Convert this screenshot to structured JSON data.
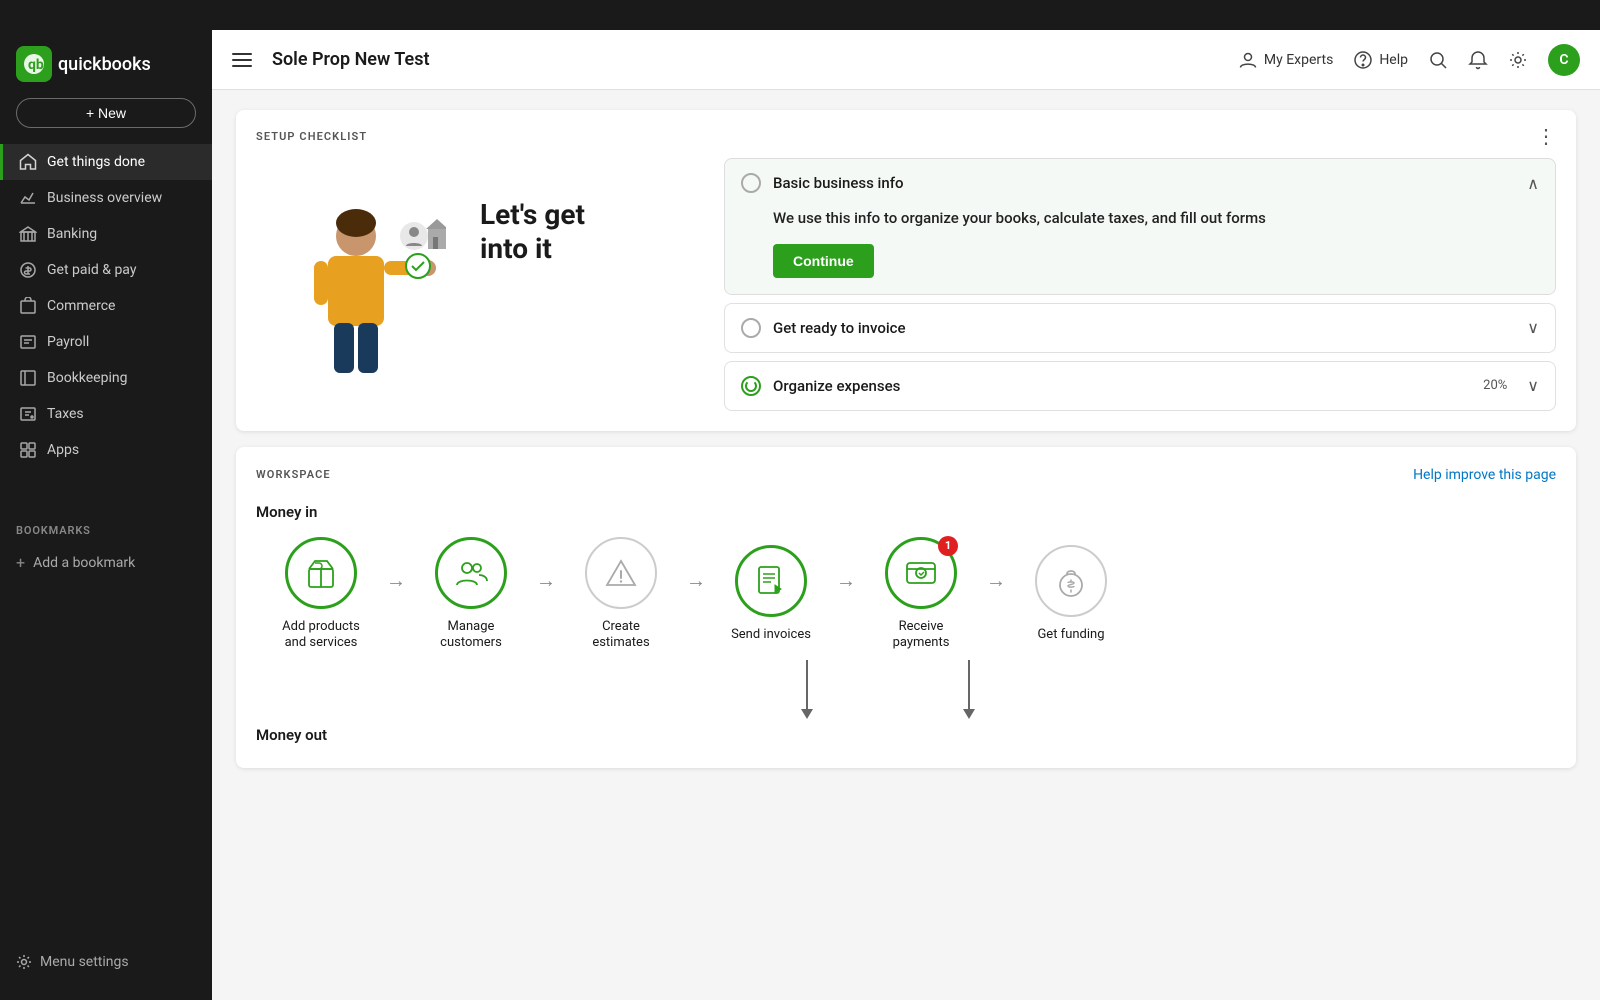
{
  "topbar": {},
  "sidebar": {
    "logo_text": "quickbooks",
    "new_button_label": "+ New",
    "nav_items": [
      {
        "id": "get-things-done",
        "label": "Get things done",
        "icon": "home",
        "active": true
      },
      {
        "id": "business-overview",
        "label": "Business overview",
        "icon": "chart",
        "active": false
      },
      {
        "id": "banking",
        "label": "Banking",
        "icon": "bank",
        "active": false
      },
      {
        "id": "get-paid-pay",
        "label": "Get paid & pay",
        "icon": "dollar",
        "active": false
      },
      {
        "id": "commerce",
        "label": "Commerce",
        "icon": "commerce",
        "active": false
      },
      {
        "id": "payroll",
        "label": "Payroll",
        "icon": "payroll",
        "active": false
      },
      {
        "id": "bookkeeping",
        "label": "Bookkeeping",
        "icon": "book",
        "active": false
      },
      {
        "id": "taxes",
        "label": "Taxes",
        "icon": "tax",
        "active": false
      },
      {
        "id": "apps",
        "label": "Apps",
        "icon": "apps",
        "active": false
      }
    ],
    "bookmarks_label": "BOOKMARKS",
    "add_bookmark_label": "Add a bookmark",
    "menu_settings_label": "Menu settings"
  },
  "header": {
    "title": "Sole Prop New Test",
    "my_experts_label": "My Experts",
    "help_label": "Help",
    "avatar_letter": "C"
  },
  "setup_checklist": {
    "section_label": "SETUP CHECKLIST",
    "title_line1": "Let's get",
    "title_line2": "into it",
    "items": [
      {
        "id": "basic-info",
        "label": "Basic business info",
        "expanded": true,
        "description": "We use this info to organize your books, calculate taxes, and fill out forms",
        "button_label": "Continue",
        "progress": null,
        "radio_state": "empty"
      },
      {
        "id": "invoice",
        "label": "Get ready to invoice",
        "expanded": false,
        "description": "",
        "button_label": "",
        "progress": null,
        "radio_state": "empty"
      },
      {
        "id": "expenses",
        "label": "Organize expenses",
        "expanded": false,
        "description": "",
        "button_label": "",
        "progress": "20%",
        "radio_state": "progress"
      }
    ]
  },
  "workspace": {
    "section_label": "WORKSPACE",
    "help_improve_label": "Help improve this page",
    "money_in_label": "Money in",
    "money_out_label": "Money out",
    "workflow_items": [
      {
        "id": "add-products",
        "label": "Add products\nand services",
        "icon": "box",
        "active": true,
        "badge": null
      },
      {
        "id": "manage-customers",
        "label": "Manage\ncustomers",
        "icon": "people",
        "active": true,
        "badge": null
      },
      {
        "id": "create-estimates",
        "label": "Create\nestimates",
        "icon": "warning",
        "active": false,
        "badge": null
      },
      {
        "id": "send-invoices",
        "label": "Send invoices",
        "icon": "invoice",
        "active": true,
        "badge": null
      },
      {
        "id": "receive-payments",
        "label": "Receive\npayments",
        "icon": "payment",
        "active": true,
        "badge": 1
      },
      {
        "id": "get-funding",
        "label": "Get funding",
        "icon": "moneybag",
        "active": false,
        "badge": null
      }
    ]
  }
}
